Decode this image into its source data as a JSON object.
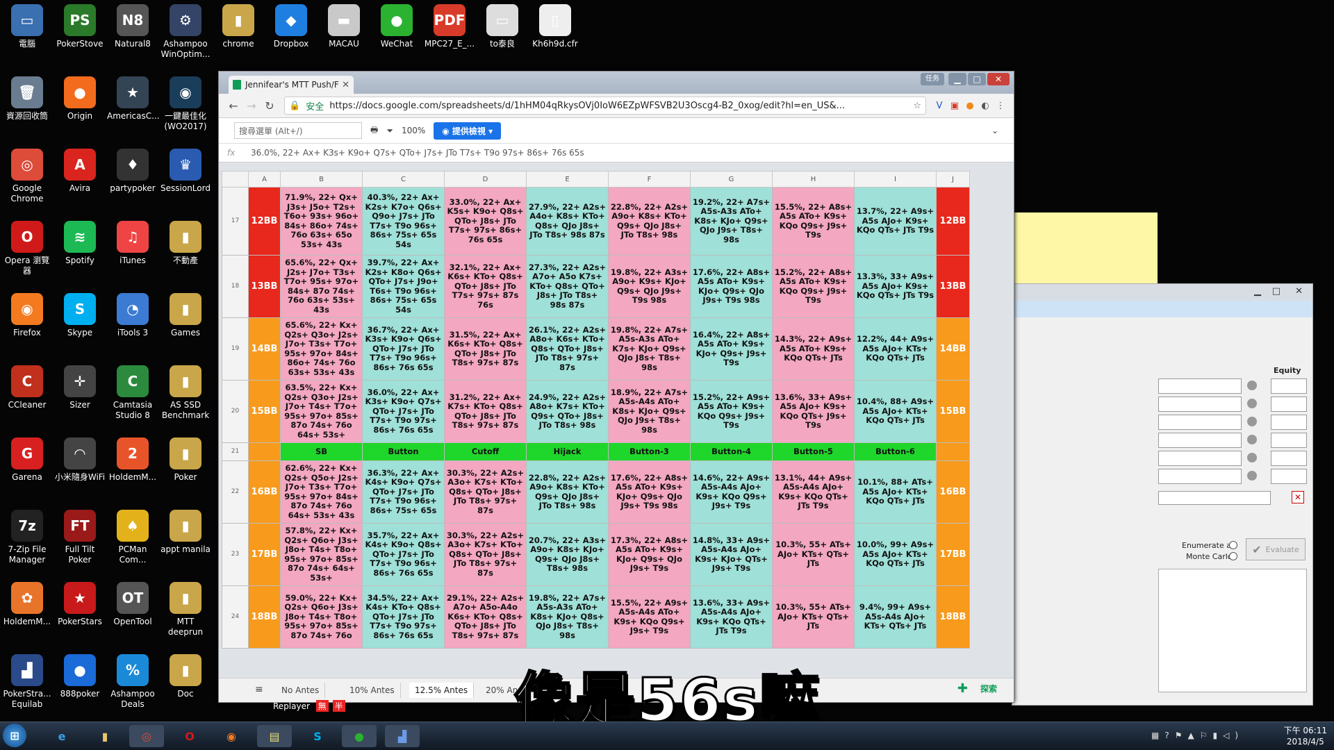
{
  "desktop_icons": [
    {
      "label": "電腦",
      "glyph": "▭",
      "color": "#3a6fb0"
    },
    {
      "label": "PokerStove",
      "glyph": "PS",
      "color": "#2a7a2a"
    },
    {
      "label": "Natural8",
      "glyph": "N8",
      "color": "#555"
    },
    {
      "label": "Ashampoo WinOptim...",
      "glyph": "⚙",
      "color": "#346"
    },
    {
      "label": "chrome",
      "glyph": "▮",
      "color": "#c9a64a"
    },
    {
      "label": "Dropbox",
      "glyph": "◆",
      "color": "#1e7fe0"
    },
    {
      "label": "MACAU",
      "glyph": "▬",
      "color": "#c9c9c9"
    },
    {
      "label": "WeChat",
      "glyph": "●",
      "color": "#2ab230"
    },
    {
      "label": "MPC27_E_...",
      "glyph": "PDF",
      "color": "#d83b2a"
    },
    {
      "label": "to泰良",
      "glyph": "▭",
      "color": "#ddd"
    },
    {
      "label": "Kh6h9d.cfr",
      "glyph": "▯",
      "color": "#eee"
    },
    {
      "label": "資源回收筒",
      "glyph": "🗑",
      "color": "#6a7c90"
    },
    {
      "label": "Origin",
      "glyph": "●",
      "color": "#f36b1c"
    },
    {
      "label": "AmericasC...",
      "glyph": "★",
      "color": "#345"
    },
    {
      "label": "一鍵最佳化 (WO2017)",
      "glyph": "◉",
      "color": "#1a3d5a"
    },
    {
      "label": "Google Chrome",
      "glyph": "◎",
      "color": "#dd4b39"
    },
    {
      "label": "Avira",
      "glyph": "A",
      "color": "#d9251d"
    },
    {
      "label": "partypoker",
      "glyph": "♦",
      "color": "#333"
    },
    {
      "label": "SessionLord",
      "glyph": "♛",
      "color": "#2a5bb0"
    },
    {
      "label": "Opera 瀏覽器",
      "glyph": "O",
      "color": "#d01a1a"
    },
    {
      "label": "Spotify",
      "glyph": "≋",
      "color": "#1db954"
    },
    {
      "label": "iTunes",
      "glyph": "♫",
      "color": "#e44"
    },
    {
      "label": "不動產",
      "glyph": "▮",
      "color": "#c9a64a"
    },
    {
      "label": "Firefox",
      "glyph": "◉",
      "color": "#f47a20"
    },
    {
      "label": "Skype",
      "glyph": "S",
      "color": "#00aff0"
    },
    {
      "label": "iTools 3",
      "glyph": "◔",
      "color": "#3b7bd4"
    },
    {
      "label": "Games",
      "glyph": "▮",
      "color": "#c9a64a"
    },
    {
      "label": "CCleaner",
      "glyph": "C",
      "color": "#c0301c"
    },
    {
      "label": "Sizer",
      "glyph": "✛",
      "color": "#444"
    },
    {
      "label": "Camtasia Studio 8",
      "glyph": "C",
      "color": "#2b8a3e"
    },
    {
      "label": "AS SSD Benchmark",
      "glyph": "▮",
      "color": "#c9a64a"
    },
    {
      "label": "Garena",
      "glyph": "G",
      "color": "#d82020"
    },
    {
      "label": "小米隨身WiFi",
      "glyph": "◠",
      "color": "#444"
    },
    {
      "label": "HoldemM...",
      "glyph": "2",
      "color": "#e8542a"
    },
    {
      "label": "Poker",
      "glyph": "▮",
      "color": "#c9a64a"
    },
    {
      "label": "7-Zip File Manager",
      "glyph": "7z",
      "color": "#222"
    },
    {
      "label": "Full Tilt Poker",
      "glyph": "FT",
      "color": "#9a1a1a"
    },
    {
      "label": "PCMan Com...",
      "glyph": "♠",
      "color": "#e3b21a"
    },
    {
      "label": "appt manila",
      "glyph": "▮",
      "color": "#c9a64a"
    },
    {
      "label": "HoldemM...",
      "glyph": "✿",
      "color": "#e8742a"
    },
    {
      "label": "PokerStars",
      "glyph": "★",
      "color": "#c81a1a"
    },
    {
      "label": "OpenTool",
      "glyph": "OT",
      "color": "#555"
    },
    {
      "label": "MTT deeprun",
      "glyph": "▮",
      "color": "#c9a64a"
    },
    {
      "label": "PokerStra... Equilab",
      "glyph": "▟",
      "color": "#2a4a8a"
    },
    {
      "label": "888poker",
      "glyph": "●",
      "color": "#1a6ad8"
    },
    {
      "label": "Ashampoo Deals",
      "glyph": "%",
      "color": "#1a8ad8"
    },
    {
      "label": "Doc",
      "glyph": "▮",
      "color": "#c9a64a"
    }
  ],
  "browser": {
    "tab_title": "Jennifear's MTT Push/F",
    "secure_label": "安全",
    "url": "https://docs.google.com/spreadsheets/d/1hHM04qRkysOVj0IoW6EZpWFSVB2U3Oscg4-B2_0xog/edit?hl=en_US&...",
    "window_button": "任务"
  },
  "sheet_toolbar": {
    "menu_search": "搜尋選單 (Alt+/)",
    "zoom": "100%",
    "present": "提供檢視"
  },
  "formula": {
    "fx": "fx",
    "content": "36.0%, 22+ Ax+ K3s+ K9o+ Q7s+ QTo+ J7s+ JTo T7s+ T9o 97s+ 86s+ 76s 65s"
  },
  "columns": [
    "",
    "A",
    "B",
    "C",
    "D",
    "E",
    "F",
    "G",
    "H",
    "I",
    "J"
  ],
  "rows": [
    {
      "num": "17",
      "a": "12BB",
      "cells": [
        "71.9%, 22+ Qx+ J3s+ J5o+ T2s+ T6o+ 93s+ 96o+ 84s+ 86o+ 74s+ 76o 63s+ 65o 53s+ 43s",
        "40.3%, 22+ Ax+ K2s+ K7o+ Q6s+ Q9o+ J7s+ JTo T7s+ T9o 96s+ 86s+ 75s+ 65s 54s",
        "33.0%, 22+ Ax+ K5s+ K9o+ Q8s+ QTo+ J8s+ JTo T7s+ 97s+ 86s+ 76s 65s",
        "27.9%, 22+ A2s+ A4o+ K8s+ KTo+ Q8s+ QJo J8s+ JTo T8s+ 98s 87s",
        "22.8%, 22+ A2s+ A9o+ K8s+ KTo+ Q9s+ QJo J8s+ JTo T8s+ 98s",
        "19.2%, 22+ A7s+ A5s-A3s ATo+ K8s+ KJo+ Q9s+ QJo J9s+ T8s+ 98s",
        "15.5%, 22+ A8s+ A5s ATo+ K9s+ KQo Q9s+ J9s+ T9s",
        "13.7%, 22+ A9s+ A5s AJo+ K9s+ KQo QTs+ JTs T9s"
      ],
      "j": "12BB",
      "color": "red"
    },
    {
      "num": "18",
      "a": "13BB",
      "cells": [
        "65.6%, 22+ Qx+ J2s+ J7o+ T3s+ T7o+ 95s+ 97o+ 84s+ 87o 74s+ 76o 63s+ 53s+ 43s",
        "39.7%, 22+ Ax+ K2s+ K8o+ Q6s+ QTo+ J7s+ J9o+ T6s+ T9o 96s+ 86s+ 75s+ 65s 54s",
        "32.1%, 22+ Ax+ K6s+ KTo+ Q8s+ QTo+ J8s+ JTo T7s+ 97s+ 87s 76s",
        "27.3%, 22+ A2s+ A7o+ A5o K7s+ KTo+ Q8s+ QTo+ J8s+ JTo T8s+ 98s 87s",
        "19.8%, 22+ A3s+ A9o+ K9s+ KJo+ Q9s+ QJo J9s+ T9s 98s",
        "17.6%, 22+ A8s+ A5s ATo+ K9s+ KJo+ Q9s+ QJo J9s+ T9s 98s",
        "15.2%, 22+ A8s+ A5s ATo+ K9s+ KQo Q9s+ J9s+ T9s",
        "13.3%, 33+ A9s+ A5s AJo+ K9s+ KQo QTs+ JTs T9s"
      ],
      "j": "13BB",
      "color": "red"
    },
    {
      "num": "19",
      "a": "14BB",
      "cells": [
        "65.6%, 22+ Kx+ Q2s+ Q3o+ J2s+ J7o+ T3s+ T7o+ 95s+ 97o+ 84s+ 86o+ 74s+ 76o 63s+ 53s+ 43s",
        "36.7%, 22+ Ax+ K3s+ K9o+ Q6s+ QTo+ J7s+ JTo T7s+ T9o 96s+ 86s+ 76s 65s",
        "31.5%, 22+ Ax+ K6s+ KTo+ Q8s+ QTo+ J8s+ JTo T8s+ 97s+ 87s",
        "26.1%, 22+ A2s+ A8o+ K6s+ KTo+ Q8s+ QTo+ J8s+ JTo T8s+ 97s+ 87s",
        "19.8%, 22+ A7s+ A5s-A3s ATo+ K7s+ KJo+ Q9s+ QJo J8s+ T8s+ 98s",
        "16.4%, 22+ A8s+ A5s ATo+ K9s+ KJo+ Q9s+ J9s+ T9s",
        "14.3%, 22+ A9s+ A5s ATo+ K9s+ KQo QTs+ JTs",
        "12.2%, 44+ A9s+ A5s AJo+ KTs+ KQo QTs+ JTs"
      ],
      "j": "14BB",
      "color": "org"
    },
    {
      "num": "20",
      "a": "15BB",
      "cells": [
        "63.5%, 22+ Kx+ Q2s+ Q3o+ J2s+ J7o+ T4s+ T7o+ 95s+ 97o+ 85s+ 87o 74s+ 76o 64s+ 53s+",
        "36.0%, 22+ Ax+ K3s+ K9o+ Q7s+ QTo+ J7s+ JTo T7s+ T9o 97s+ 86s+ 76s 65s",
        "31.2%, 22+ Ax+ K7s+ KTo+ Q8s+ QTo+ J8s+ JTo T8s+ 97s+ 87s",
        "24.9%, 22+ A2s+ A8o+ K7s+ KTo+ Q9s+ QTo+ J8s+ JTo T8s+ 98s",
        "18.9%, 22+ A7s+ A5s-A4s ATo+ K8s+ KJo+ Q9s+ QJo J9s+ T8s+ 98s",
        "15.2%, 22+ A9s+ A5s ATo+ K9s+ KQo Q9s+ J9s+ T9s",
        "13.6%, 33+ A9s+ A5s AJo+ K9s+ KQo QTs+ J9s+ T9s",
        "10.4%, 88+ A9s+ A5s AJo+ KTs+ KQo QTs+ JTs"
      ],
      "j": "15BB",
      "color": "org"
    },
    {
      "num": "21",
      "a": "",
      "cells": [
        "SB",
        "Button",
        "Cutoff",
        "Hijack",
        "Button-3",
        "Button-4",
        "Button-5",
        "Button-6"
      ],
      "j": "",
      "color": "hdr"
    },
    {
      "num": "22",
      "a": "16BB",
      "cells": [
        "62.6%, 22+ Kx+ Q2s+ Q5o+ J2s+ J7o+ T3s+ T7o+ 95s+ 97o+ 84s+ 87o 74s+ 76o 64s+ 53s+ 43s",
        "36.3%, 22+ Ax+ K4s+ K9o+ Q7s+ QTo+ J7s+ JTo T7s+ T9o 96s+ 86s+ 75s+ 65s",
        "30.3%, 22+ A2s+ A3o+ K7s+ KTo+ Q8s+ QTo+ J8s+ JTo T8s+ 97s+ 87s",
        "22.8%, 22+ A2s+ A9o+ K8s+ KTo+ Q9s+ QJo J8s+ JTo T8s+ 98s",
        "17.6%, 22+ A8s+ A5s ATo+ K9s+ KJo+ Q9s+ QJo J9s+ T9s 98s",
        "14.6%, 22+ A9s+ A5s-A4s AJo+ K9s+ KQo Q9s+ J9s+ T9s",
        "13.1%, 44+ A9s+ A5s-A4s AJo+ K9s+ KQo QTs+ JTs T9s",
        "10.1%, 88+ ATs+ A5s AJo+ KTs+ KQo QTs+ JTs"
      ],
      "j": "16BB",
      "color": "org"
    },
    {
      "num": "23",
      "a": "17BB",
      "cells": [
        "57.8%, 22+ Kx+ Q2s+ Q6o+ J3s+ J8o+ T4s+ T8o+ 95s+ 97o+ 85s+ 87o 74s+ 64s+ 53s+",
        "35.7%, 22+ Ax+ K4s+ K9o+ Q8s+ QTo+ J7s+ JTo T7s+ T9o 96s+ 86s+ 76s 65s",
        "30.3%, 22+ A2s+ A3o+ K7s+ KTo+ Q8s+ QTo+ J8s+ JTo T8s+ 97s+ 87s",
        "20.7%, 22+ A3s+ A9o+ K8s+ KJo+ Q9s+ QJo J8s+ T8s+ 98s",
        "17.3%, 22+ A8s+ A5s ATo+ K9s+ KJo+ Q9s+ QJo J9s+ T9s",
        "14.8%, 33+ A9s+ A5s-A4s AJo+ K9s+ KJo+ QTs+ J9s+ T9s",
        "10.3%, 55+ ATs+ AJo+ KTs+ QTs+ JTs",
        "10.0%, 99+ A9s+ A5s AJo+ KTs+ KQo QTs+ JTs"
      ],
      "j": "17BB",
      "color": "org"
    },
    {
      "num": "24",
      "a": "18BB",
      "cells": [
        "59.0%, 22+ Kx+ Q2s+ Q6o+ J3s+ J8o+ T4s+ T8o+ 95s+ 97o+ 85s+ 87o 74s+ 76o",
        "34.5%, 22+ Ax+ K4s+ KTo+ Q8s+ QTo+ J7s+ JTo T7s+ T9o 97s+ 86s+ 76s 65s",
        "29.1%, 22+ A2s+ A7o+ A5o-A4o K6s+ KTo+ Q8s+ QTo+ J8s+ JTo T8s+ 97s+ 87s",
        "19.8%, 22+ A7s+ A5s-A3s ATo+ K8s+ KJo+ Q8s+ QJo J8s+ T8s+ 98s",
        "15.5%, 22+ A9s+ A5s-A4s ATo+ K9s+ KQo Q9s+ J9s+ T9s",
        "13.6%, 33+ A9s+ A5s-A4s AJo+ K9s+ KQo QTs+ JTs T9s",
        "10.3%, 55+ ATs+ AJo+ KTs+ QTs+ JTs",
        "9.4%, 99+ A9s+ A5s-A4s AJo+ KTs+ QTs+ JTs"
      ],
      "j": "18BB",
      "color": "org"
    }
  ],
  "sheet_tabs": [
    "No Antes",
    "10% Antes",
    "12.5% Antes",
    "20% An"
  ],
  "explore_label": "探索",
  "equilab": {
    "equity_header": "Equity",
    "enumerate_label": "Enumerate all",
    "monte_carlo_label": "Monte Carlo",
    "evaluate_label": "Evaluate"
  },
  "replay": {
    "label": "Replayer",
    "badge1": "無",
    "badge2": "半"
  },
  "subtitle": "像是56s嘛",
  "clock": {
    "time": "下午 06:11",
    "date": "2018/4/5"
  }
}
